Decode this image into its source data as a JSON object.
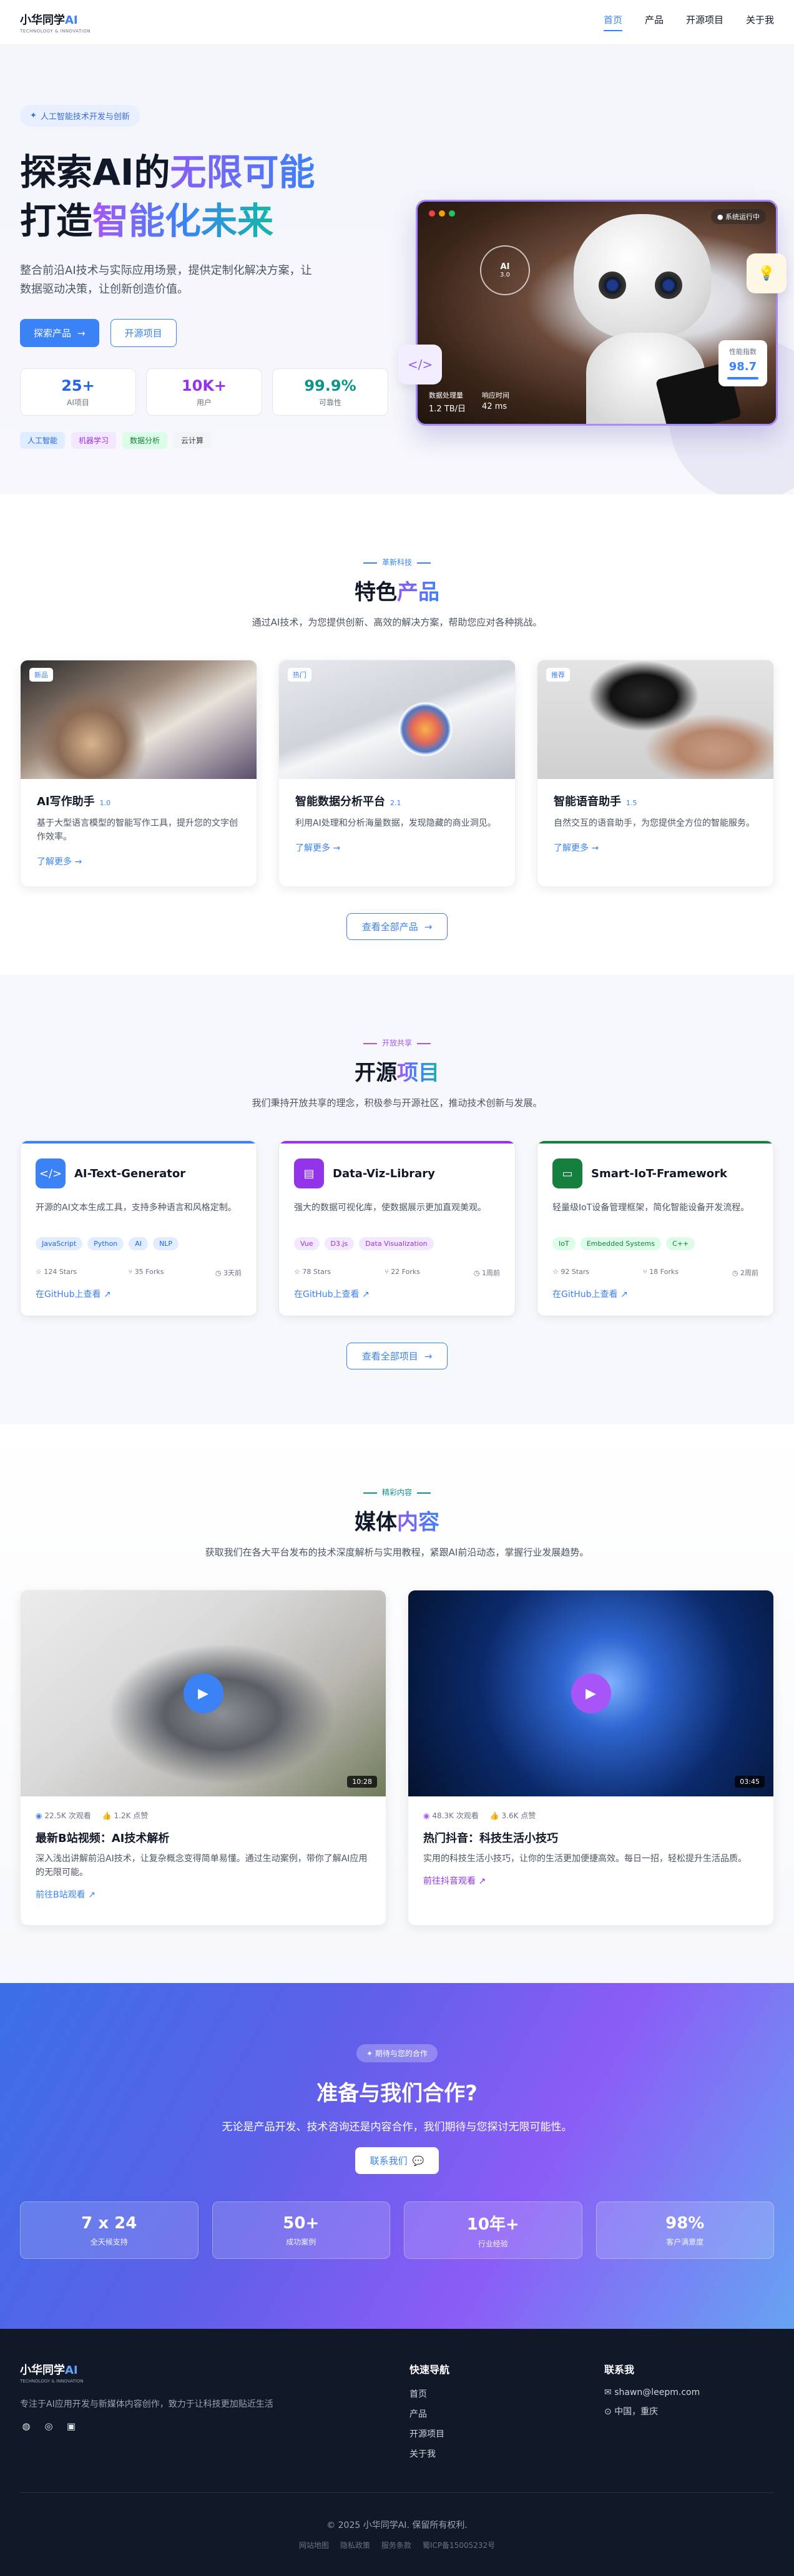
{
  "header": {
    "logo_main": "小华同学",
    "logo_ai": "AI",
    "logo_sub": "TECHNOLOGY & INNOVATION",
    "nav": [
      "首页",
      "产品",
      "开源项目",
      "关于我"
    ]
  },
  "hero": {
    "pill": "人工智能技术开发与创新",
    "title_line1_a": "探索AI的",
    "title_line1_b": "无限可能",
    "title_line2_a": "打造",
    "title_line2_b": "智能化未来",
    "desc": "整合前沿AI技术与实际应用场景，提供定制化解决方案，让数据驱动决策，让创新创造价值。",
    "btn_primary": "探索产品",
    "btn_secondary": "开源项目",
    "stats": [
      {
        "value": "25+",
        "label": "AI项目",
        "color": "#2563eb"
      },
      {
        "value": "10K+",
        "label": "用户",
        "color": "#9333ea"
      },
      {
        "value": "99.9%",
        "label": "可靠性",
        "color": "#0d9488"
      }
    ],
    "tags": [
      {
        "label": "人工智能",
        "bg": "#e0ecff",
        "fg": "#2563eb"
      },
      {
        "label": "机器学习",
        "bg": "#f3e8ff",
        "fg": "#9333ea"
      },
      {
        "label": "数据分析",
        "bg": "#dcfce7",
        "fg": "#15803d"
      },
      {
        "label": "云计算",
        "bg": "#f3f4f6",
        "fg": "#374151"
      }
    ],
    "image": {
      "sys_label": "系统运行中",
      "ai_label": "AI",
      "ai_version": "3.0",
      "metric1_label": "数据处理量",
      "metric1_value": "1.2 TB/日",
      "metric2_label": "响应时间",
      "metric2_value": "42 ms",
      "score_label": "性能指数",
      "score_value": "98.7"
    }
  },
  "products": {
    "eyebrow": "革新科技",
    "title_a": "特色",
    "title_b": "产品",
    "subtitle": "通过AI技术，为您提供创新、高效的解决方案，帮助您应对各种挑战。",
    "items": [
      {
        "badge": "新品",
        "name": "AI写作助手",
        "version": "1.0",
        "desc": "基于大型语言模型的智能写作工具，提升您的文字创作效率。",
        "link": "了解更多"
      },
      {
        "badge": "热门",
        "name": "智能数据分析平台",
        "version": "2.1",
        "desc": "利用AI处理和分析海量数据，发现隐藏的商业洞见。",
        "link": "了解更多"
      },
      {
        "badge": "推荐",
        "name": "智能语音助手",
        "version": "1.5",
        "desc": "自然交互的语音助手，为您提供全方位的智能服务。",
        "link": "了解更多"
      }
    ],
    "view_all": "查看全部产品"
  },
  "opensource": {
    "eyebrow": "开放共享",
    "title_a": "开源",
    "title_b": "项目",
    "subtitle": "我们秉持开放共享的理念，积极参与开源社区，推动技术创新与发展。",
    "items": [
      {
        "name": "AI-Text-Generator",
        "desc": "开源的AI文本生成工具，支持多种语言和风格定制。",
        "tags": [
          "JavaScript",
          "Python",
          "AI",
          "NLP"
        ],
        "stars": "124 Stars",
        "forks": "35 Forks",
        "updated": "3天前",
        "link": "在GitHub上查看",
        "accent": "#3b82f6",
        "tag_bg": "#e0ecff",
        "tag_fg": "#2563eb"
      },
      {
        "name": "Data-Viz-Library",
        "desc": "强大的数据可视化库，使数据展示更加直观美观。",
        "tags": [
          "Vue",
          "D3.js",
          "Data Visualization"
        ],
        "stars": "78 Stars",
        "forks": "22 Forks",
        "updated": "1周前",
        "link": "在GitHub上查看",
        "accent": "#9333ea",
        "tag_bg": "#f3e8ff",
        "tag_fg": "#9333ea"
      },
      {
        "name": "Smart-IoT-Framework",
        "desc": "轻量级IoT设备管理框架，简化智能设备开发流程。",
        "tags": [
          "IoT",
          "Embedded Systems",
          "C++"
        ],
        "stars": "92 Stars",
        "forks": "18 Forks",
        "updated": "2周前",
        "link": "在GitHub上查看",
        "accent": "#15803d",
        "tag_bg": "#dcfce7",
        "tag_fg": "#15803d"
      }
    ],
    "view_all": "查看全部项目"
  },
  "media": {
    "eyebrow": "精彩内容",
    "title_a": "媒体",
    "title_b": "内容",
    "subtitle": "获取我们在各大平台发布的技术深度解析与实用教程，紧跟AI前沿动态，掌握行业发展趋势。",
    "items": [
      {
        "views": "22.5K 次观看",
        "likes": "1.2K 点赞",
        "duration": "10:28",
        "title": "最新B站视频：AI技术解析",
        "desc": "深入浅出讲解前沿AI技术，让复杂概念变得简单易懂。通过生动案例，带你了解AI应用的无限可能。",
        "link": "前往B站观看"
      },
      {
        "views": "48.3K 次观看",
        "likes": "3.6K 点赞",
        "duration": "03:45",
        "title": "热门抖音：科技生活小技巧",
        "desc": "实用的科技生活小技巧，让你的生活更加便捷高效。每日一招，轻松提升生活品质。",
        "link": "前往抖音观看"
      }
    ]
  },
  "cta": {
    "pill": "期待与您的合作",
    "title": "准备与我们合作?",
    "subtitle": "无论是产品开发、技术咨询还是内容合作，我们期待与您探讨无限可能性。",
    "button": "联系我们",
    "stats": [
      {
        "value": "7 x 24",
        "label": "全天候支持"
      },
      {
        "value": "50+",
        "label": "成功案例"
      },
      {
        "value": "10年+",
        "label": "行业经验"
      },
      {
        "value": "98%",
        "label": "客户满意度"
      }
    ]
  },
  "footer": {
    "logo_main": "小华同学",
    "logo_ai": "AI",
    "logo_sub": "TECHNOLOGY & INNOVATION",
    "desc": "专注于AI应用开发与新媒体内容创作，致力于让科技更加贴近生活",
    "nav_title": "快速导航",
    "nav": [
      "首页",
      "产品",
      "开源项目",
      "关于我"
    ],
    "contact_title": "联系我",
    "email": "shawn@leepm.com",
    "location": "中国，重庆",
    "copyright": "© 2025 小华同学AI. 保留所有权利.",
    "links": [
      "网站地图",
      "隐私政策",
      "服务条款",
      "蜀ICP备15005232号"
    ]
  }
}
